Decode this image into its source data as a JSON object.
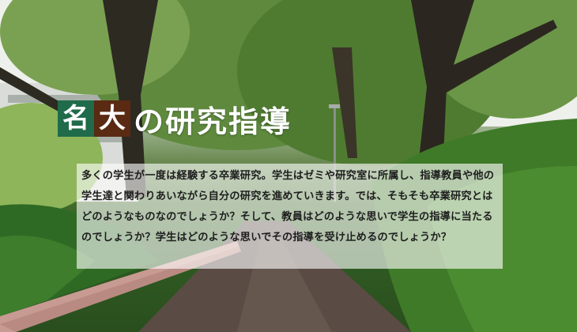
{
  "title": {
    "char1": "名",
    "char2": "大",
    "rest": "の研究指導"
  },
  "intro": {
    "text": "多くの学生が一度は経験する卒業研究。学生はゼミや研究室に所属し、指導教員や他の学生達と関わりあいながら自分の研究を進めていきます。では、そもそも卒業研究とはどのようなものなのでしょうか？そして、教員はどのような思いで学生の指導に当たるのでしょうか？学生はどのような思いでその指導を受け止めるのでしょうか？"
  },
  "colors": {
    "title_box_1": "#1f6b4a",
    "title_box_2": "#5a2a12",
    "title_text": "#ffffff",
    "panel_background": "rgba(255,255,255,0.62)"
  }
}
